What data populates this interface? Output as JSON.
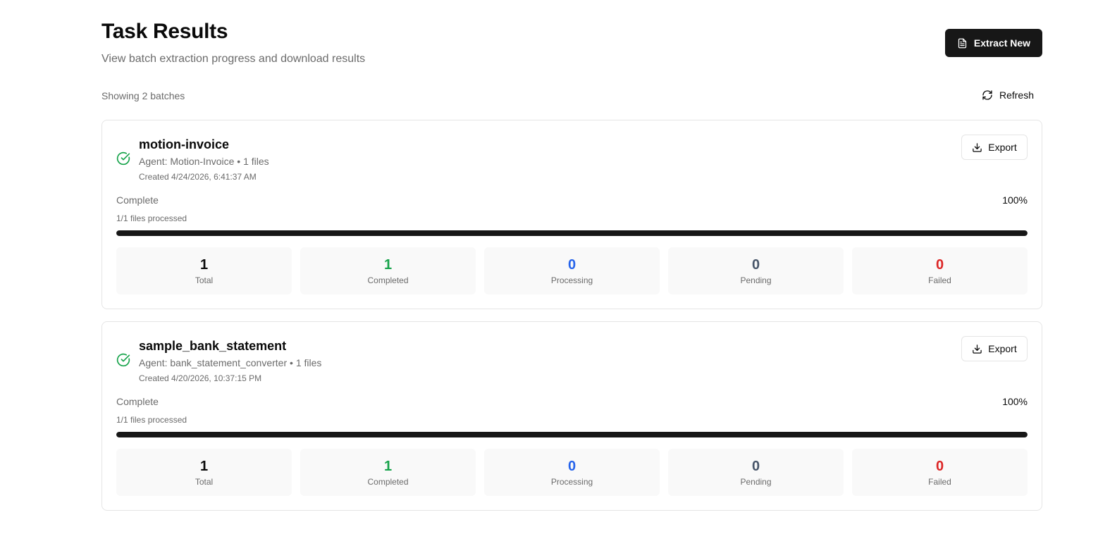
{
  "header": {
    "title": "Task Results",
    "subtitle": "View batch extraction progress and download results",
    "extract_button_label": "Extract New",
    "extract_button_icon": "file-text-icon"
  },
  "toolbar": {
    "showing_text": "Showing 2 batches",
    "refresh_label": "Refresh",
    "refresh_icon": "refresh-icon"
  },
  "colors": {
    "primary": "#171717",
    "success": "#16a34a",
    "processing": "#2563eb",
    "pending": "#475569",
    "failed": "#dc2626",
    "muted": "#6b6b6b"
  },
  "batches": [
    {
      "name": "motion-invoice",
      "agent_line": "Agent: Motion-Invoice",
      "files_line": "1 files",
      "created": "Created 4/24/2026, 6:41:37 AM",
      "status_icon": "check-circle-icon",
      "export_label": "Export",
      "export_icon": "download-icon",
      "progress_label": "Complete",
      "progress_percent_text": "100%",
      "progress_fraction": 1.0,
      "files_processed": "1/1 files processed",
      "stats": [
        {
          "value": "1",
          "label": "Total",
          "color": "#0a0a0a"
        },
        {
          "value": "1",
          "label": "Completed",
          "color": "#16a34a"
        },
        {
          "value": "0",
          "label": "Processing",
          "color": "#2563eb"
        },
        {
          "value": "0",
          "label": "Pending",
          "color": "#475569"
        },
        {
          "value": "0",
          "label": "Failed",
          "color": "#dc2626"
        }
      ]
    },
    {
      "name": "sample_bank_statement",
      "agent_line": "Agent: bank_statement_converter",
      "files_line": "1 files",
      "created": "Created 4/20/2026, 10:37:15 PM",
      "status_icon": "check-circle-icon",
      "export_label": "Export",
      "export_icon": "download-icon",
      "progress_label": "Complete",
      "progress_percent_text": "100%",
      "progress_fraction": 1.0,
      "files_processed": "1/1 files processed",
      "stats": [
        {
          "value": "1",
          "label": "Total",
          "color": "#0a0a0a"
        },
        {
          "value": "1",
          "label": "Completed",
          "color": "#16a34a"
        },
        {
          "value": "0",
          "label": "Processing",
          "color": "#2563eb"
        },
        {
          "value": "0",
          "label": "Pending",
          "color": "#475569"
        },
        {
          "value": "0",
          "label": "Failed",
          "color": "#dc2626"
        }
      ]
    }
  ]
}
